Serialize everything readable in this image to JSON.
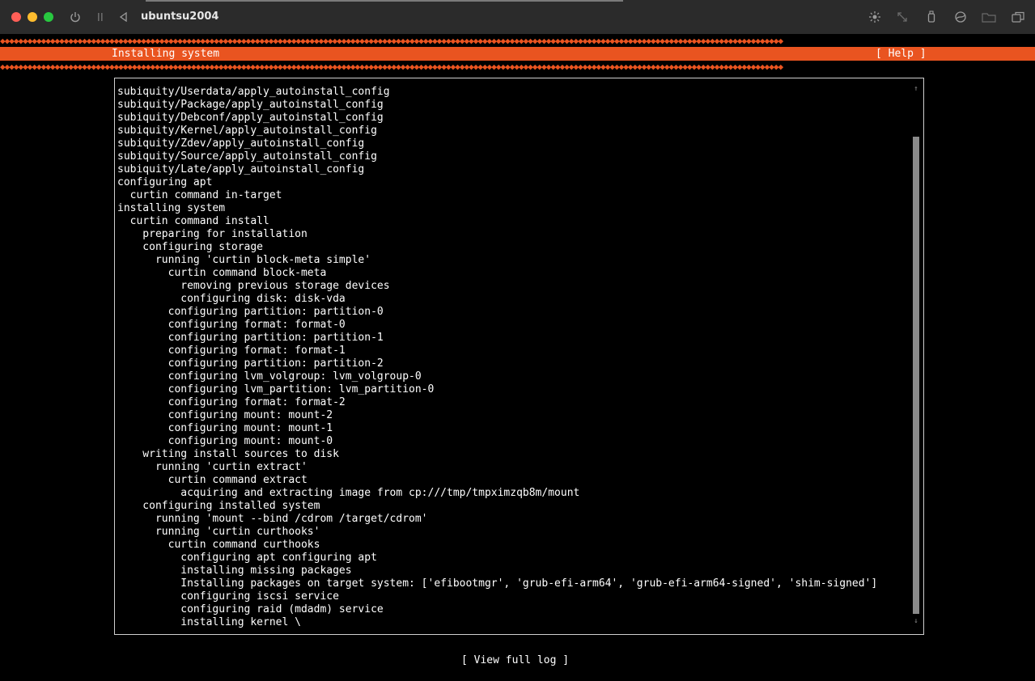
{
  "window": {
    "title": "ubuntsu2004",
    "controls": [
      "close-light",
      "minimize-light",
      "zoom-light"
    ],
    "colors": {
      "close": "#ff5f57",
      "minimize": "#febc2e",
      "zoom": "#28c840"
    },
    "left_icons": [
      "power-icon",
      "pause-icon",
      "back-icon"
    ],
    "right_icons": [
      "brightness-icon",
      "resize-icon",
      "usb-icon",
      "network-icon",
      "folder-icon",
      "windows-icon"
    ]
  },
  "installer": {
    "header_title": "Installing system",
    "help_label": "[ Help ]",
    "accent_color": "#e95420",
    "diamond_row": "◆◆◆◆◆◆◆◆◆◆◆◆◆◆◆◆◆◆◆◆◆◆◆◆◆◆◆◆◆◆◆◆◆◆◆◆◆◆◆◆◆◆◆◆◆◆◆◆◆◆◆◆◆◆◆◆◆◆◆◆◆◆◆◆◆◆◆◆◆◆◆◆◆◆◆◆◆◆◆◆◆◆◆◆◆◆◆◆◆◆◆◆◆◆◆◆◆◆◆◆◆◆◆◆◆◆◆◆◆◆◆◆◆◆◆◆◆◆◆◆◆◆◆◆◆◆◆◆◆◆◆◆◆◆◆◆◆◆◆◆◆◆◆◆◆◆◆◆◆◆◆◆◆◆◆◆◆◆◆◆◆◆◆◆◆◆◆◆◆◆◆◆",
    "scroll_up": "↑",
    "scroll_down": "↓",
    "view_log_label": "[ View full log ]",
    "log_lines": [
      "subiquity/Userdata/apply_autoinstall_config",
      "subiquity/Package/apply_autoinstall_config",
      "subiquity/Debconf/apply_autoinstall_config",
      "subiquity/Kernel/apply_autoinstall_config",
      "subiquity/Zdev/apply_autoinstall_config",
      "subiquity/Source/apply_autoinstall_config",
      "subiquity/Late/apply_autoinstall_config",
      "configuring apt",
      "  curtin command in-target",
      "installing system",
      "  curtin command install",
      "    preparing for installation",
      "    configuring storage",
      "      running 'curtin block-meta simple'",
      "        curtin command block-meta",
      "          removing previous storage devices",
      "          configuring disk: disk-vda",
      "        configuring partition: partition-0",
      "        configuring format: format-0",
      "        configuring partition: partition-1",
      "        configuring format: format-1",
      "        configuring partition: partition-2",
      "        configuring lvm_volgroup: lvm_volgroup-0",
      "        configuring lvm_partition: lvm_partition-0",
      "        configuring format: format-2",
      "        configuring mount: mount-2",
      "        configuring mount: mount-1",
      "        configuring mount: mount-0",
      "    writing install sources to disk",
      "      running 'curtin extract'",
      "        curtin command extract",
      "          acquiring and extracting image from cp:///tmp/tmpximzqb8m/mount",
      "    configuring installed system",
      "      running 'mount --bind /cdrom /target/cdrom'",
      "      running 'curtin curthooks'",
      "        curtin command curthooks",
      "          configuring apt configuring apt",
      "          installing missing packages",
      "          Installing packages on target system: ['efibootmgr', 'grub-efi-arm64', 'grub-efi-arm64-signed', 'shim-signed']",
      "          configuring iscsi service",
      "          configuring raid (mdadm) service",
      "          installing kernel \\"
    ]
  }
}
